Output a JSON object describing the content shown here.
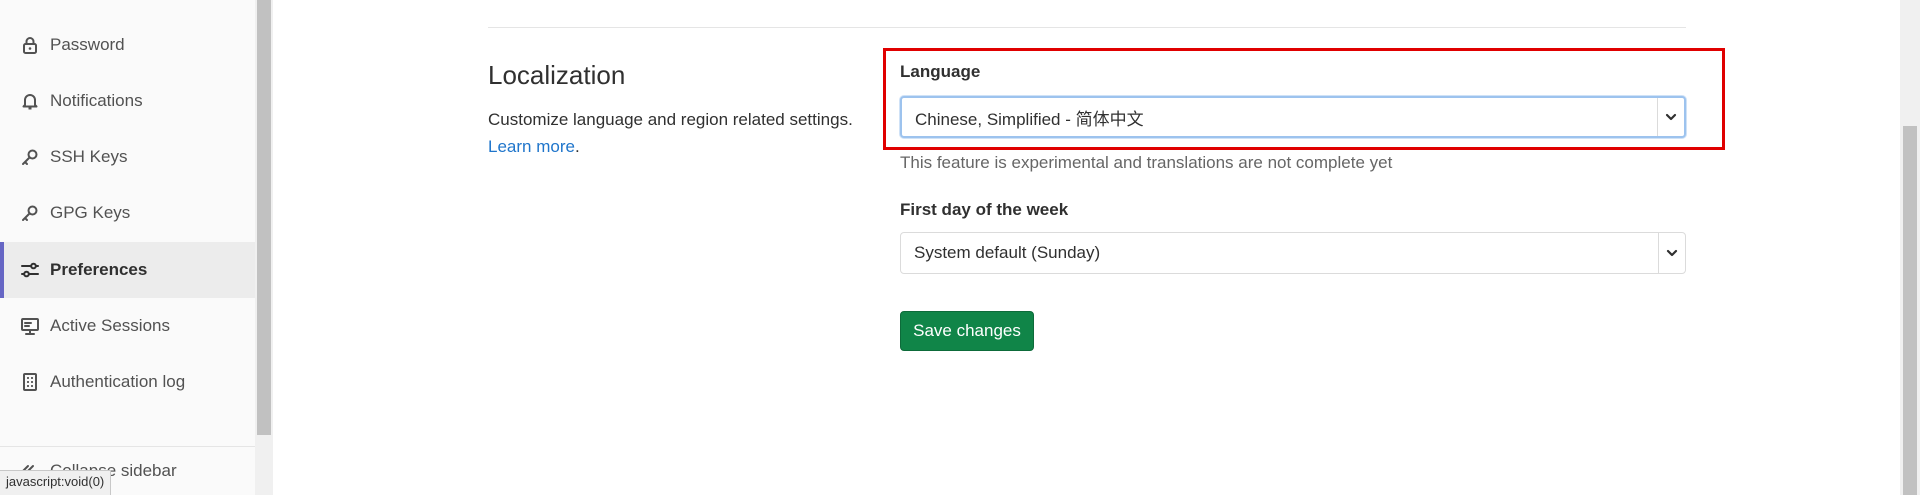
{
  "sidebar": {
    "items": [
      {
        "label": "Password",
        "icon": "lock-icon",
        "active": false
      },
      {
        "label": "Notifications",
        "icon": "bell-icon",
        "active": false
      },
      {
        "label": "SSH Keys",
        "icon": "key-icon",
        "active": false
      },
      {
        "label": "GPG Keys",
        "icon": "key-icon",
        "active": false
      },
      {
        "label": "Preferences",
        "icon": "preferences-icon",
        "active": true
      },
      {
        "label": "Active Sessions",
        "icon": "monitor-icon",
        "active": false
      },
      {
        "label": "Authentication log",
        "icon": "log-icon",
        "active": false
      }
    ],
    "collapse_label": "Collapse sidebar",
    "status_text": "javascript:void(0)"
  },
  "localization": {
    "title": "Localization",
    "description": "Customize language and region related settings.",
    "learn_more": "Learn more",
    "learn_more_suffix": ".",
    "language_label": "Language",
    "language_value": "Chinese, Simplified - 简体中文",
    "language_help": "This feature is experimental and translations are not complete yet",
    "first_day_label": "First day of the week",
    "first_day_value": "System default (Sunday)",
    "save_label": "Save changes"
  },
  "colors": {
    "accent": "#6666c4",
    "save_button": "#108548",
    "highlight": "#e00000",
    "link": "#1f75cb"
  }
}
